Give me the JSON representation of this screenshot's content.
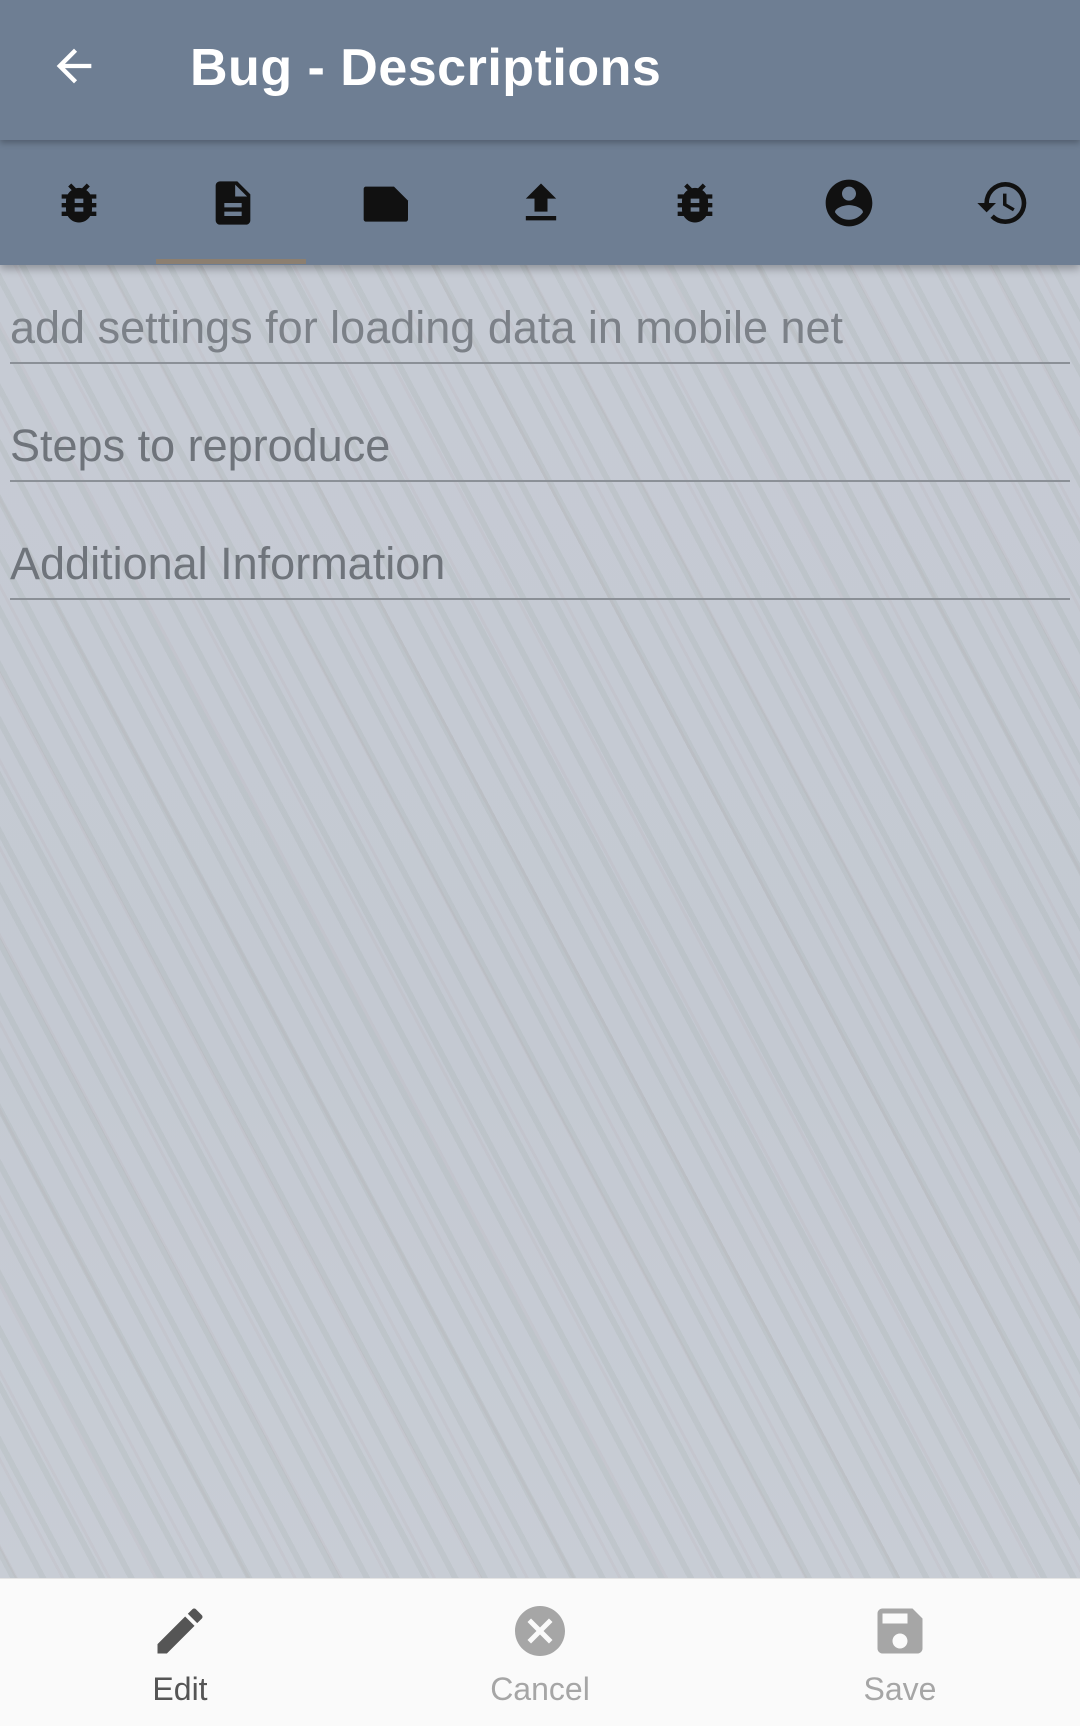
{
  "header": {
    "title": "Bug - Descriptions",
    "back_icon": "arrow-left-icon",
    "color": "#6e7e93"
  },
  "tabs": [
    {
      "icon": "bug-icon",
      "selected": false
    },
    {
      "icon": "document-icon",
      "selected": true
    },
    {
      "icon": "label-icon",
      "selected": false
    },
    {
      "icon": "upload-icon",
      "selected": false
    },
    {
      "icon": "bug-icon",
      "selected": false
    },
    {
      "icon": "account-circle-icon",
      "selected": false
    },
    {
      "icon": "history-icon",
      "selected": false
    }
  ],
  "form": {
    "description_value": "add settings for loading data in mobile net",
    "steps_placeholder": "Steps to reproduce",
    "additional_placeholder": "Additional Information"
  },
  "bottom_actions": {
    "edit_label": "Edit",
    "cancel_label": "Cancel",
    "save_label": "Save",
    "enabled_color": "#555555",
    "disabled_color": "#a6a6a6"
  }
}
